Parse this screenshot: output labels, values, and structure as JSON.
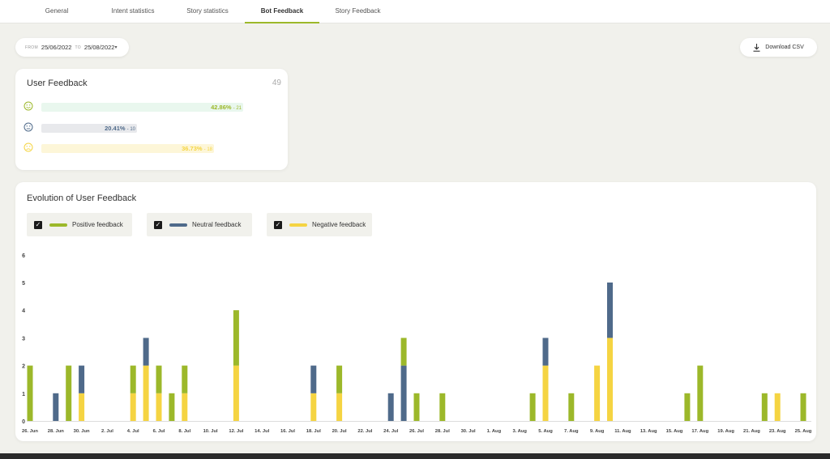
{
  "tabs": [
    {
      "label": "General",
      "active": false
    },
    {
      "label": "Intent statistics",
      "active": false
    },
    {
      "label": "Story statistics",
      "active": false
    },
    {
      "label": "Bot Feedback",
      "active": true
    },
    {
      "label": "Story Feedback",
      "active": false
    }
  ],
  "date_range": {
    "from_label": "FROM",
    "from": "25/06/2022",
    "to_label": "TO",
    "to": "25/08/2022",
    "caret": "▾"
  },
  "download": {
    "label": "Download CSV"
  },
  "user_feedback": {
    "title": "User Feedback",
    "total": "49",
    "rows": [
      {
        "key": "positive",
        "percent": "42.86%",
        "count": "- 21",
        "fraction": 0.8571,
        "icon": "smile-icon",
        "color": "#9cb82a",
        "bg": "#e9f7ee"
      },
      {
        "key": "neutral",
        "percent": "20.41%",
        "count": "- 10",
        "fraction": 0.4081,
        "icon": "neutral-face-icon",
        "color": "#4f6a8a",
        "bg": "#e8e9ec"
      },
      {
        "key": "negative",
        "percent": "36.73%",
        "count": "- 18",
        "fraction": 0.7346,
        "icon": "sad-face-icon",
        "color": "#f5d442",
        "bg": "#fdf6d8"
      }
    ]
  },
  "evolution": {
    "title": "Evolution of User Feedback",
    "legend": [
      {
        "label": "Positive feedback",
        "color": "#9cb82a",
        "checked": true
      },
      {
        "label": "Neutral feedback",
        "color": "#4f6a8a",
        "checked": true
      },
      {
        "label": "Negative feedback",
        "color": "#f5d442",
        "checked": true
      }
    ]
  },
  "chart_data": {
    "type": "bar",
    "stacked": true,
    "ylim": [
      0,
      6
    ],
    "yticks": [
      0,
      1,
      2,
      3,
      4,
      5,
      6
    ],
    "categories": [
      "26. Jun",
      "27. Jun",
      "28. Jun",
      "29. Jun",
      "30. Jun",
      "1. Jul",
      "2. Jul",
      "3. Jul",
      "4. Jul",
      "5. Jul",
      "6. Jul",
      "7. Jul",
      "8. Jul",
      "9. Jul",
      "10. Jul",
      "11. Jul",
      "12. Jul",
      "13. Jul",
      "14. Jul",
      "15. Jul",
      "16. Jul",
      "17. Jul",
      "18. Jul",
      "19. Jul",
      "20. Jul",
      "21. Jul",
      "22. Jul",
      "23. Jul",
      "24. Jul",
      "25. Jul",
      "26. Jul",
      "27. Jul",
      "28. Jul",
      "29. Jul",
      "30. Jul",
      "31. Jul",
      "1. Aug",
      "2. Aug",
      "3. Aug",
      "4. Aug",
      "5. Aug",
      "6. Aug",
      "7. Aug",
      "8. Aug",
      "9. Aug",
      "10. Aug",
      "11. Aug",
      "12. Aug",
      "13. Aug",
      "14. Aug",
      "15. Aug",
      "16. Aug",
      "17. Aug",
      "18. Aug",
      "19. Aug",
      "20. Aug",
      "21. Aug",
      "22. Aug",
      "23. Aug",
      "24. Aug",
      "25. Aug"
    ],
    "tick_labels": [
      "26. Jun",
      "28. Jun",
      "30. Jun",
      "2. Jul",
      "4. Jul",
      "6. Jul",
      "8. Jul",
      "10. Jul",
      "12. Jul",
      "14. Jul",
      "16. Jul",
      "18. Jul",
      "20. Jul",
      "22. Jul",
      "24. Jul",
      "26. Jul",
      "28. Jul",
      "30. Jul",
      "1. Aug",
      "3. Aug",
      "5. Aug",
      "7. Aug",
      "9. Aug",
      "11. Aug",
      "13. Aug",
      "15. Aug",
      "17. Aug",
      "19. Aug",
      "21. Aug",
      "23. Aug",
      "25. Aug"
    ],
    "series": [
      {
        "name": "Negative feedback",
        "color": "#f5d442",
        "values": [
          0,
          0,
          0,
          0,
          1,
          0,
          0,
          0,
          1,
          2,
          1,
          0,
          1,
          0,
          0,
          0,
          2,
          0,
          0,
          0,
          0,
          0,
          1,
          0,
          1,
          0,
          0,
          0,
          0,
          0,
          0,
          0,
          0,
          0,
          0,
          0,
          0,
          0,
          0,
          0,
          2,
          0,
          0,
          0,
          2,
          3,
          0,
          0,
          0,
          0,
          0,
          0,
          0,
          0,
          0,
          0,
          0,
          0,
          1,
          0,
          0
        ]
      },
      {
        "name": "Neutral feedback",
        "color": "#4f6a8a",
        "values": [
          0,
          0,
          1,
          0,
          1,
          0,
          0,
          0,
          0,
          1,
          0,
          0,
          0,
          0,
          0,
          0,
          0,
          0,
          0,
          0,
          0,
          0,
          1,
          0,
          0,
          0,
          0,
          0,
          1,
          2,
          0,
          0,
          0,
          0,
          0,
          0,
          0,
          0,
          0,
          0,
          1,
          0,
          0,
          0,
          0,
          2,
          0,
          0,
          0,
          0,
          0,
          0,
          0,
          0,
          0,
          0,
          0,
          0,
          0,
          0,
          0
        ]
      },
      {
        "name": "Positive feedback",
        "color": "#9cb82a",
        "values": [
          2,
          0,
          0,
          2,
          0,
          0,
          0,
          0,
          1,
          0,
          1,
          1,
          1,
          0,
          0,
          0,
          2,
          0,
          0,
          0,
          0,
          0,
          0,
          0,
          1,
          0,
          0,
          0,
          0,
          1,
          1,
          0,
          1,
          0,
          0,
          0,
          0,
          0,
          0,
          1,
          0,
          0,
          1,
          0,
          0,
          0,
          0,
          0,
          0,
          0,
          0,
          1,
          2,
          0,
          0,
          0,
          0,
          1,
          0,
          0,
          1
        ]
      }
    ]
  }
}
